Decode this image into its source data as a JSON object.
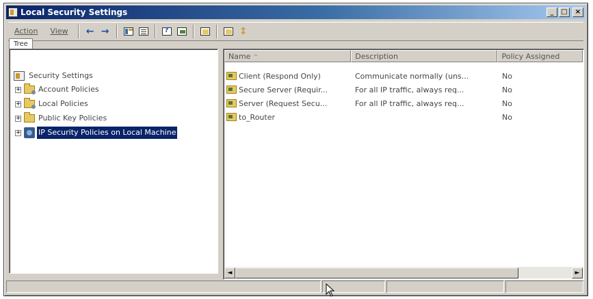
{
  "window": {
    "title": "Local Security Settings",
    "controls": {
      "minimize": "_",
      "maximize": "□",
      "close": "×"
    }
  },
  "toolbar": {
    "action_label": "Action",
    "view_label": "View",
    "icons": [
      "back-arrow-icon",
      "forward-arrow-icon",
      "show-tree-icon",
      "list-view-icon",
      "help-icon",
      "export-list-icon",
      "properties-icon",
      "refresh-icon",
      "assign-policy-icon"
    ]
  },
  "tree": {
    "tab_label": "Tree",
    "root": "Security Settings",
    "items": [
      {
        "label": "Account Policies",
        "expander": "+"
      },
      {
        "label": "Local Policies",
        "expander": "+"
      },
      {
        "label": "Public Key Policies",
        "expander": "+"
      },
      {
        "label": "IP Security Policies on Local Machine",
        "expander": "+",
        "selected": true
      }
    ]
  },
  "list": {
    "columns": [
      "Name",
      "Description",
      "Policy Assigned"
    ],
    "sort_indicator": "^",
    "rows": [
      {
        "name": "Client (Respond Only)",
        "description": "Communicate normally (uns...",
        "assigned": "No"
      },
      {
        "name": "Secure Server (Requir...",
        "description": "For all IP traffic, always req...",
        "assigned": "No"
      },
      {
        "name": "Server (Request Secu...",
        "description": "For all IP traffic, always req...",
        "assigned": "No"
      },
      {
        "name": "to_Router",
        "description": "",
        "assigned": "No"
      }
    ],
    "scroll_left": "◄",
    "scroll_right": "►"
  },
  "colors": {
    "titlebar_start": "#0a246a",
    "titlebar_end": "#a6caf0",
    "selection": "#0a246a",
    "face": "#d4d0c8"
  }
}
